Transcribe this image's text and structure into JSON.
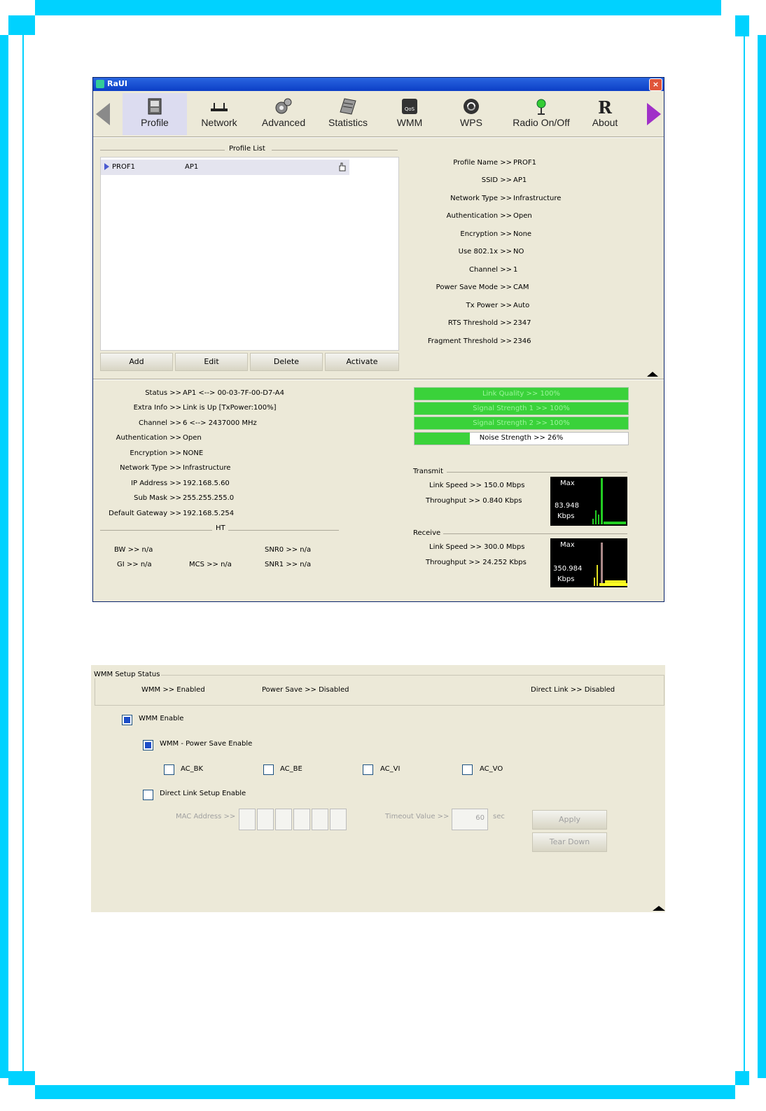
{
  "window": {
    "title": "RaUI",
    "close_glyph": "×"
  },
  "toolbar": {
    "items": [
      {
        "label": "Profile",
        "icon": "profile-icon"
      },
      {
        "label": "Network",
        "icon": "network-icon"
      },
      {
        "label": "Advanced",
        "icon": "advanced-icon"
      },
      {
        "label": "Statistics",
        "icon": "statistics-icon"
      },
      {
        "label": "WMM",
        "icon": "wmm-icon"
      },
      {
        "label": "WPS",
        "icon": "wps-icon"
      },
      {
        "label": "Radio On/Off",
        "icon": "radio-icon"
      },
      {
        "label": "About",
        "icon": "about-icon"
      }
    ]
  },
  "profile_list": {
    "title": "Profile List",
    "rows": [
      {
        "name": "PROF1",
        "ssid": "AP1"
      }
    ],
    "buttons": {
      "add": "Add",
      "edit": "Edit",
      "delete": "Delete",
      "activate": "Activate"
    }
  },
  "profile_details": [
    {
      "label": "Profile Name >>",
      "value": "PROF1"
    },
    {
      "label": "SSID >>",
      "value": "AP1"
    },
    {
      "label": "Network Type >>",
      "value": "Infrastructure"
    },
    {
      "label": "Authentication >>",
      "value": "Open"
    },
    {
      "label": "Encryption >>",
      "value": "None"
    },
    {
      "label": "Use 802.1x >>",
      "value": "NO"
    },
    {
      "label": "Channel >>",
      "value": "1"
    },
    {
      "label": "Power Save Mode >>",
      "value": "CAM"
    },
    {
      "label": "Tx Power >>",
      "value": "Auto"
    },
    {
      "label": "RTS Threshold >>",
      "value": "2347"
    },
    {
      "label": "Fragment Threshold >>",
      "value": "2346"
    }
  ],
  "status": [
    {
      "label": "Status >>",
      "value": "AP1 <--> 00-03-7F-00-D7-A4"
    },
    {
      "label": "Extra Info >>",
      "value": "Link is Up [TxPower:100%]"
    },
    {
      "label": "Channel >>",
      "value": "6 <--> 2437000 MHz"
    },
    {
      "label": "Authentication >>",
      "value": "Open"
    },
    {
      "label": "Encryption >>",
      "value": "NONE"
    },
    {
      "label": "Network Type >>",
      "value": "Infrastructure"
    },
    {
      "label": "IP Address >>",
      "value": "192.168.5.60"
    },
    {
      "label": "Sub Mask >>",
      "value": "255.255.255.0"
    },
    {
      "label": "Default Gateway >>",
      "value": "192.168.5.254"
    }
  ],
  "ht": {
    "title": "HT",
    "bw": "BW >> n/a",
    "gi": "GI >> n/a",
    "mcs": "MCS >> n/a",
    "snr0": "SNR0 >> n/a",
    "snr1": "SNR1 >> n/a"
  },
  "signal": {
    "link_quality": "Link Quality >> 100%",
    "signal1": "Signal Strength 1 >> 100%",
    "signal2": "Signal Strength 2 >> 100%",
    "noise": "Noise Strength >> 26%",
    "noise_level": 0.26,
    "bar_color": "#3ad23a"
  },
  "transmit": {
    "title": "Transmit",
    "link_speed": "Link Speed >> 150.0 Mbps",
    "throughput": "Throughput >> 0.840 Kbps",
    "graph_max": "Max",
    "graph_value": "83.948",
    "graph_unit": "Kbps"
  },
  "receive": {
    "title": "Receive",
    "link_speed": "Link Speed >> 300.0 Mbps",
    "throughput": "Throughput >> 24.252 Kbps",
    "graph_max": "Max",
    "graph_value": "350.984",
    "graph_unit": "Kbps"
  },
  "wmm": {
    "group_title": "WMM Setup Status",
    "wmm_status": "WMM >> Enabled",
    "power_save_status": "Power Save >> Disabled",
    "direct_link_status": "Direct Link >> Disabled",
    "wmm_enable": "WMM Enable",
    "ps_enable": "WMM - Power Save Enable",
    "ac_bk": "AC_BK",
    "ac_be": "AC_BE",
    "ac_vi": "AC_VI",
    "ac_vo": "AC_VO",
    "dls_enable": "Direct Link Setup Enable",
    "mac_label": "MAC Address >>",
    "timeout_label": "Timeout Value >>",
    "timeout_value": "60",
    "timeout_unit": "sec",
    "apply": "Apply",
    "teardown": "Tear Down"
  }
}
